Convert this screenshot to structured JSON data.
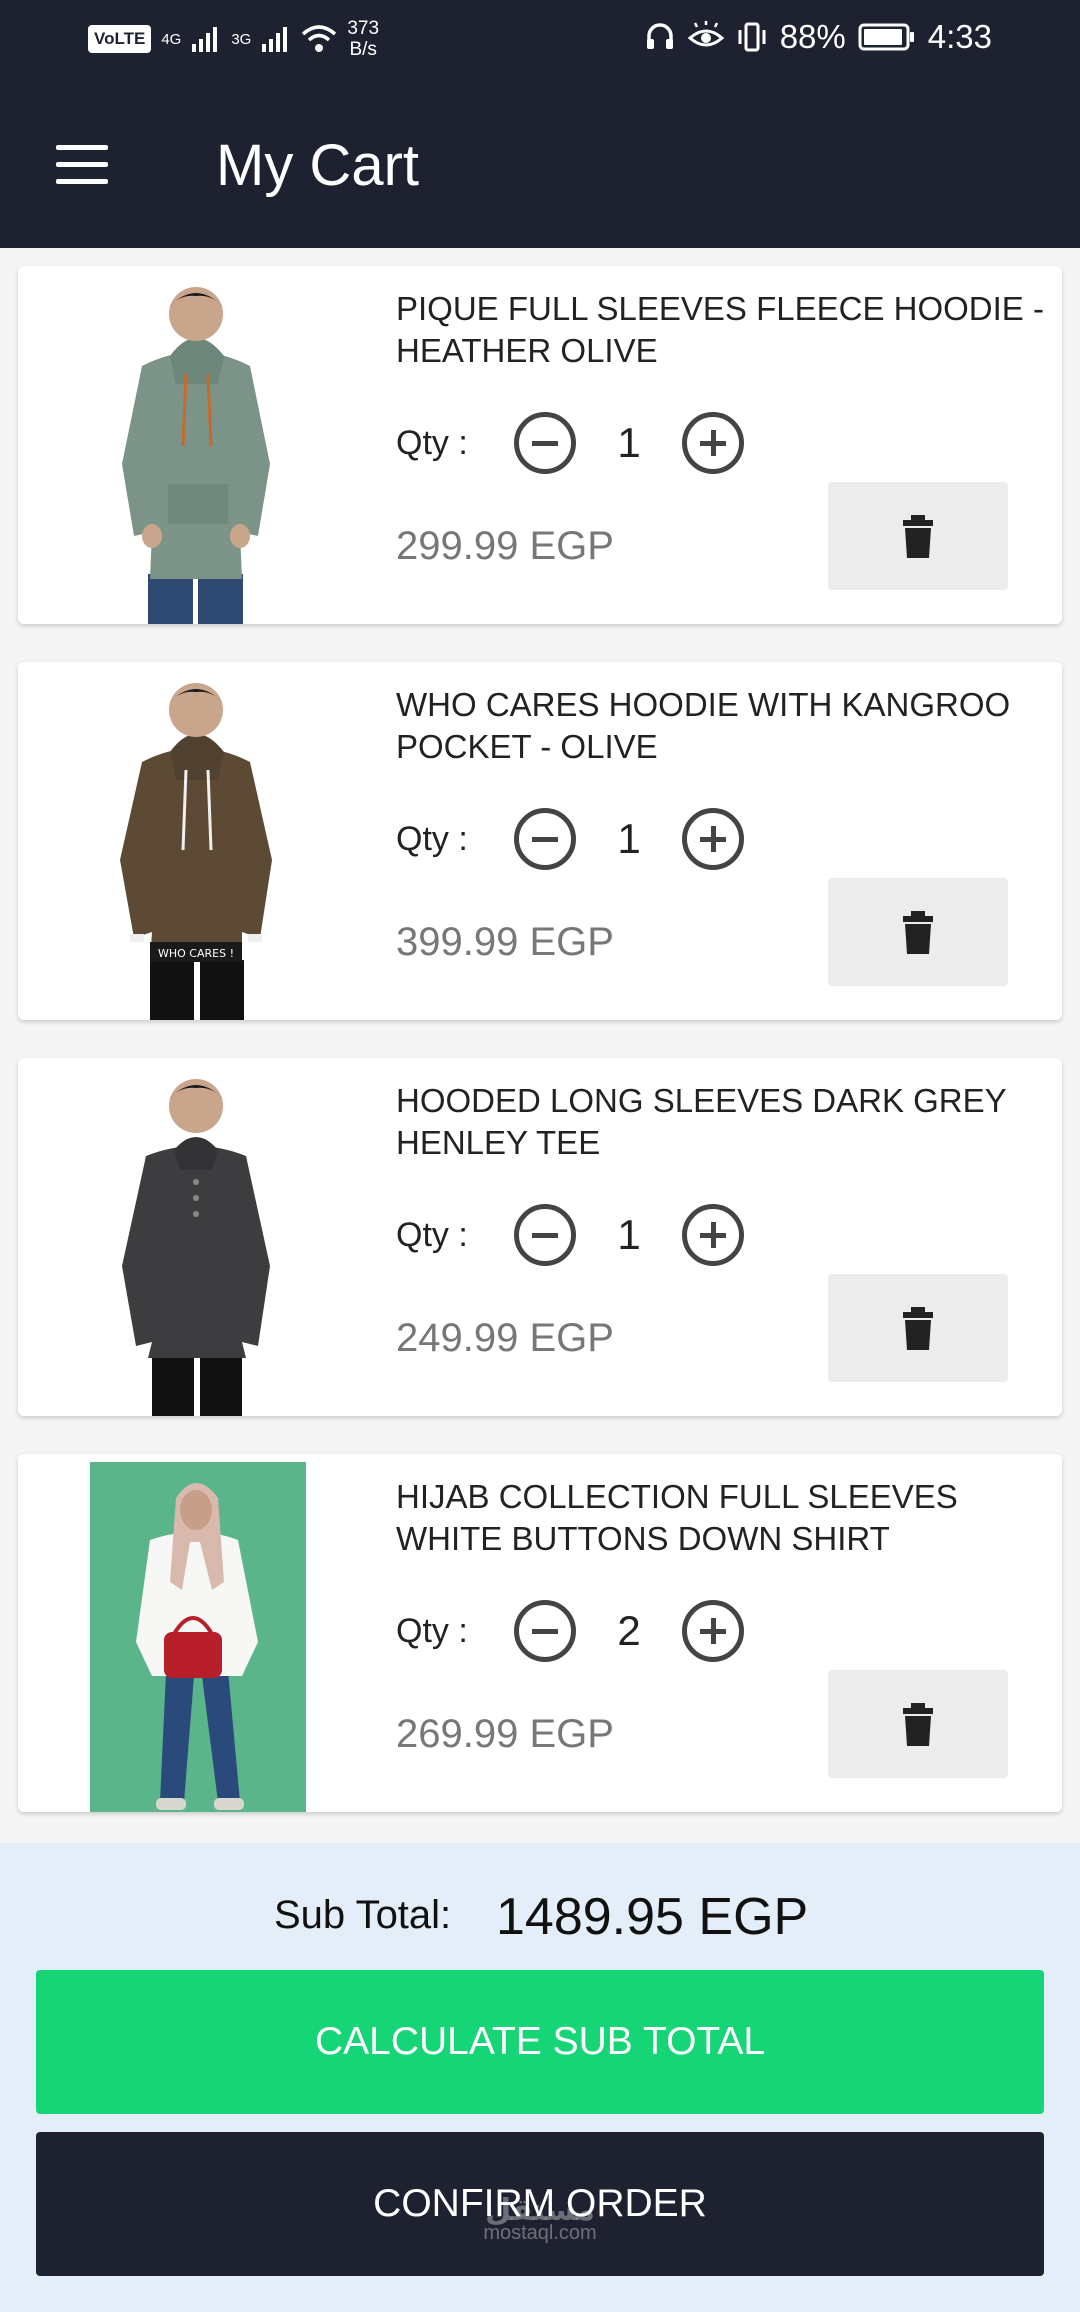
{
  "status_bar": {
    "volte": "VoLTE",
    "sim1_network": "4G",
    "sim2_network": "3G",
    "net_speed_value": "373",
    "net_speed_unit": "B/s",
    "battery": "88%",
    "time": "4:33"
  },
  "app_bar": {
    "title": "My Cart"
  },
  "cart": {
    "qty_label": "Qty :",
    "items": [
      {
        "name": "PIQUE FULL SLEEVES FLEECE HOODIE - HEATHER OLIVE",
        "qty": "1",
        "price": "299.99 EGP",
        "image": "hoodie-heather-olive"
      },
      {
        "name": "WHO CARES HOODIE WITH KANGROO POCKET - OLIVE",
        "qty": "1",
        "price": "399.99 EGP",
        "image": "hoodie-olive-who-cares",
        "print_text": "WHO CARES !"
      },
      {
        "name": "HOODED LONG SLEEVES DARK GREY HENLEY TEE",
        "qty": "1",
        "price": "249.99 EGP",
        "image": "henley-dark-grey"
      },
      {
        "name": "HIJAB COLLECTION FULL SLEEVES WHITE BUTTONS DOWN SHIRT",
        "qty": "2",
        "price": "269.99 EGP",
        "image": "white-shirt-hijab"
      }
    ]
  },
  "summary": {
    "subtotal_label": "Sub Total:",
    "subtotal_value": "1489.95 EGP",
    "calculate_label": "CALCULATE SUB TOTAL",
    "confirm_label": "CONFIRM ORDER"
  },
  "watermark": {
    "arabic": "مستقل",
    "latin": "mostaql.com"
  },
  "colors": {
    "header": "#1e2230",
    "calculate_button": "#15d577",
    "confirm_button": "#1e2230",
    "footer_bg": "#e3eef9",
    "price_text": "#777777"
  }
}
